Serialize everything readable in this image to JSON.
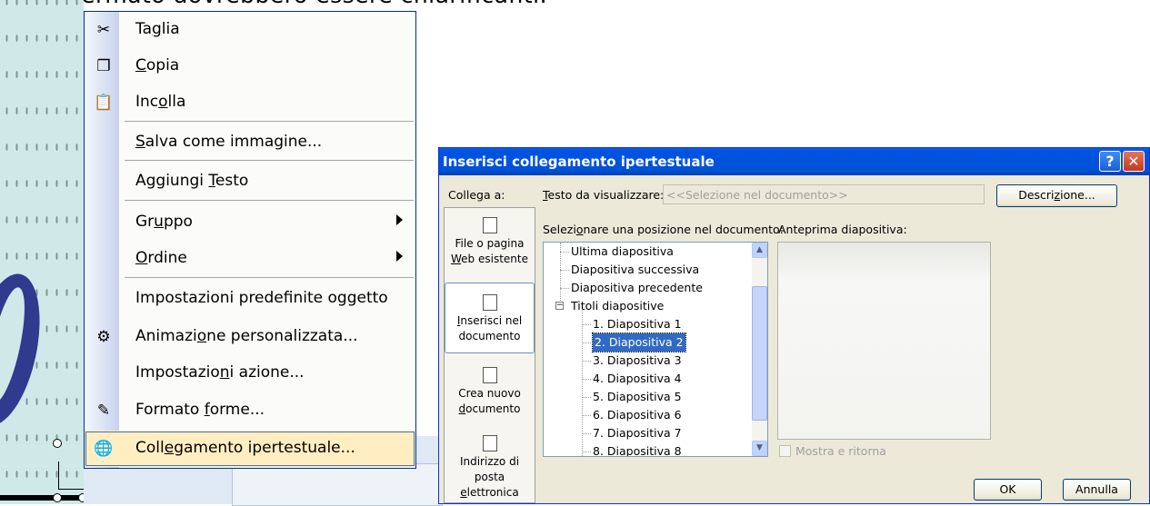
{
  "caption": "schermato dovrebbero essere chiarificanti.",
  "context_menu": {
    "items": [
      {
        "pre": "Ta",
        "ul": "g",
        "post": "lia",
        "icon": "scissors-icon"
      },
      {
        "pre": "",
        "ul": "C",
        "post": "opia",
        "icon": "copy-icon"
      },
      {
        "pre": "Inc",
        "ul": "o",
        "post": "lla",
        "icon": "paste-icon"
      },
      {
        "pre": "",
        "ul": "S",
        "post": "alva come immagine...",
        "icon": ""
      },
      {
        "pre": "Aggiungi ",
        "ul": "T",
        "post": "esto",
        "icon": ""
      },
      {
        "pre": "Gr",
        "ul": "u",
        "post": "ppo",
        "icon": "",
        "submenu": true
      },
      {
        "pre": "",
        "ul": "O",
        "post": "rdine",
        "icon": "",
        "submenu": true
      },
      {
        "pre": "Impostazioni predefinite oggetto",
        "ul": "",
        "post": "",
        "icon": ""
      },
      {
        "pre": "Animazi",
        "ul": "o",
        "post": "ne personalizzata...",
        "icon": "animation-icon"
      },
      {
        "pre": "Impostazio",
        "ul": "n",
        "post": "i azione...",
        "icon": ""
      },
      {
        "pre": "Formato ",
        "ul": "f",
        "post": "orme...",
        "icon": "format-shape-icon"
      },
      {
        "pre": "Coll",
        "ul": "e",
        "post": "gamento ipertestuale...",
        "icon": "hyperlink-icon",
        "highlighted": true
      }
    ]
  },
  "dialog": {
    "title": "Inserisci collegamento ipertestuale",
    "help_label": "?",
    "close_label": "✕",
    "collega_label": "Collega a:",
    "testo_label_ul": "T",
    "testo_label_rest": "esto da visualizzare:",
    "testo_value": "<<Selezione nel documento>>",
    "descrizione_pre": "Descri",
    "descrizione_ul": "z",
    "descrizione_post": "ione...",
    "select_pos_pre": "Selezi",
    "select_pos_ul": "o",
    "select_pos_post": "nare una posizione nel documento:",
    "preview_label": "Anteprima diapositiva:",
    "sidebar": [
      {
        "line1": "File o pagina",
        "line2_ul": "W",
        "line2": "eb esistente",
        "icon": "web-page-icon"
      },
      {
        "line1_ul": "I",
        "line1": "nserisci nel",
        "line2": "documento",
        "icon": "document-icon",
        "selected": true
      },
      {
        "line1": "Crea nuovo",
        "line2_ul": "d",
        "line2": "ocumento",
        "icon": "new-document-icon"
      },
      {
        "line1": "Indirizzo di",
        "line2": "posta",
        "line3_ul": "e",
        "line3": "lettronica",
        "icon": "email-icon"
      }
    ],
    "tree": [
      "Ultima diapositiva",
      "Diapositiva successiva",
      "Diapositiva precedente",
      "Titoli diapositive",
      "1. Diapositiva 1",
      "2. Diapositiva 2",
      "3. Diapositiva 3",
      "4. Diapositiva 4",
      "5. Diapositiva 5",
      "6. Diapositiva 6",
      "7. Diapositiva 7",
      "8. Diapositiva 8"
    ],
    "tree_expander": "−",
    "mostra_label": "Mostra e ritorna",
    "ok_label": "OK",
    "annulla_label": "Annulla"
  }
}
